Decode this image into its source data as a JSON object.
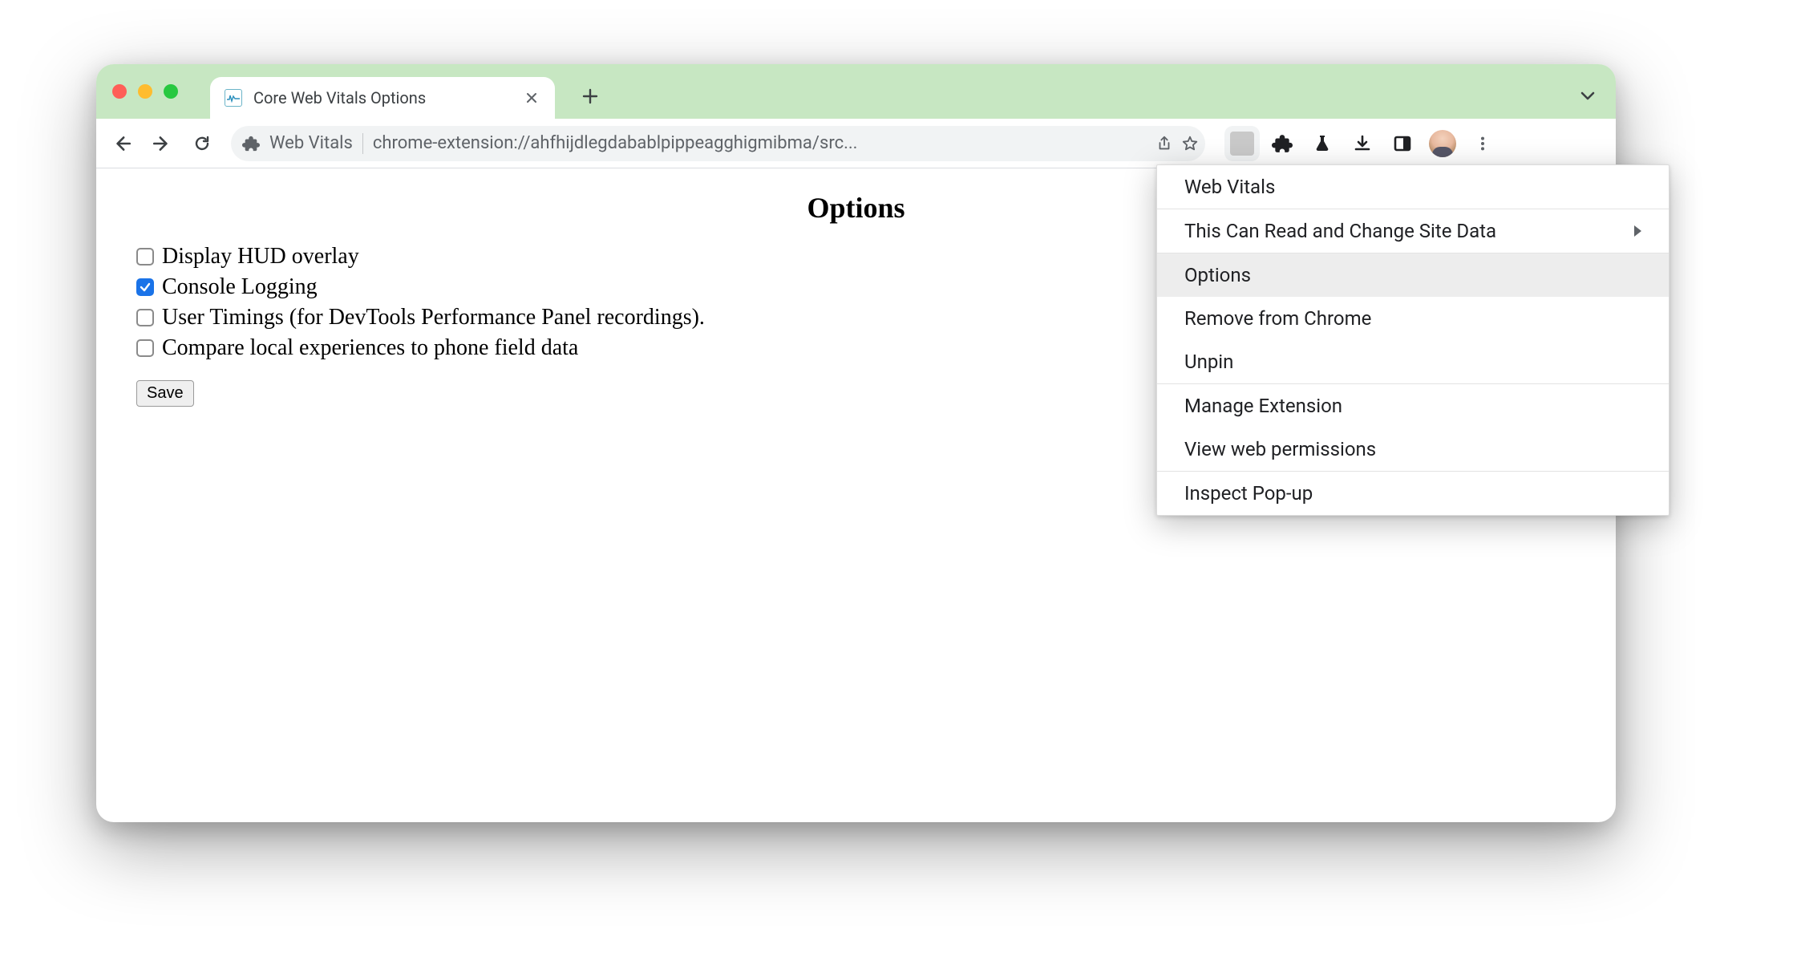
{
  "tab": {
    "title": "Core Web Vitals Options"
  },
  "omnibox": {
    "extension_name": "Web Vitals",
    "url": "chrome-extension://ahfhijdlegdabablpippeagghigmibma/src..."
  },
  "page": {
    "heading": "Options",
    "options": [
      {
        "label": "Display HUD overlay",
        "checked": false
      },
      {
        "label": "Console Logging",
        "checked": true
      },
      {
        "label": "User Timings (for DevTools Performance Panel recordings).",
        "checked": false
      },
      {
        "label": "Compare local experiences to phone field data",
        "checked": false
      }
    ],
    "save_label": "Save"
  },
  "context_menu": {
    "header": "Web Vitals",
    "items": [
      {
        "label": "This Can Read and Change Site Data",
        "submenu": true
      },
      {
        "label": "Options",
        "hovered": true
      },
      {
        "label": "Remove from Chrome"
      },
      {
        "label": "Unpin"
      },
      {
        "label": "Manage Extension"
      },
      {
        "label": "View web permissions"
      },
      {
        "label": "Inspect Pop-up"
      }
    ]
  }
}
